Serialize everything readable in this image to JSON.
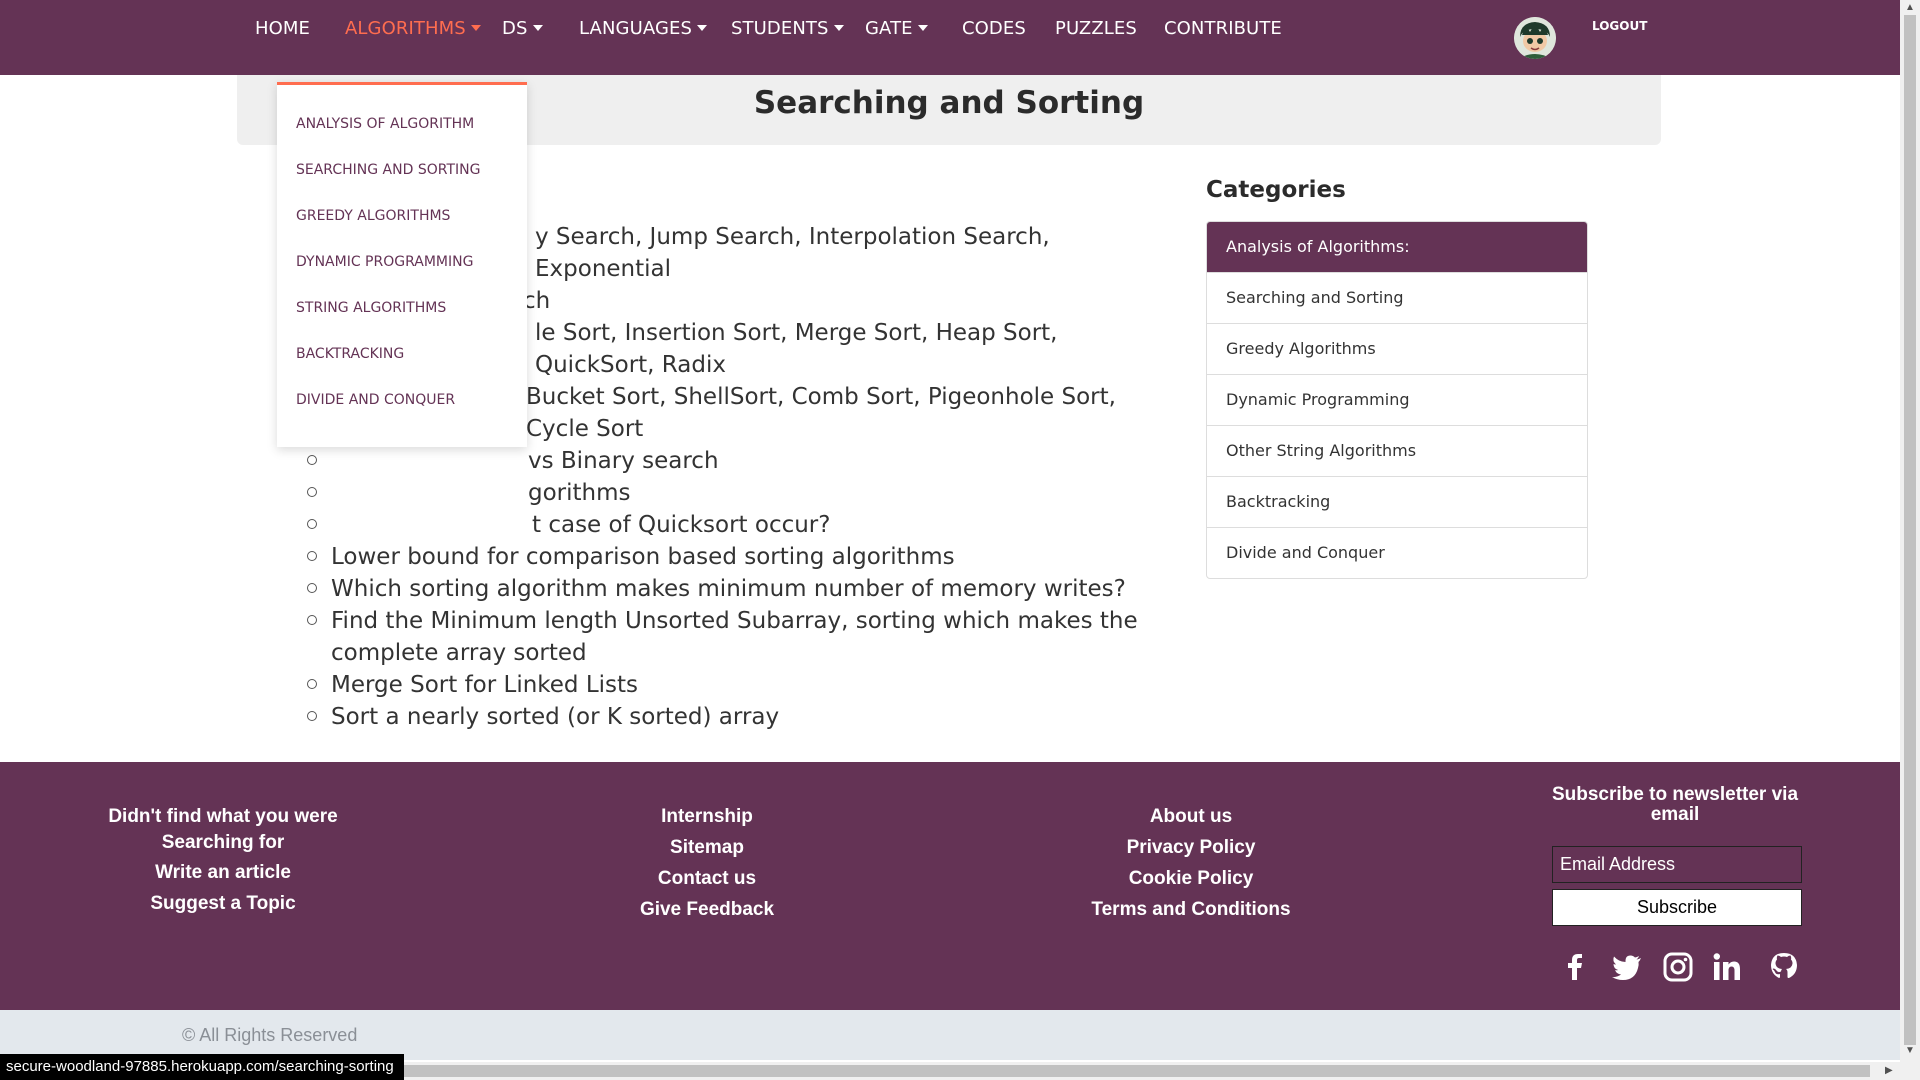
{
  "nav": {
    "items": [
      {
        "label": "HOME",
        "dropdown": false
      },
      {
        "label": "ALGORITHMS",
        "dropdown": true,
        "active": true
      },
      {
        "label": "DS",
        "dropdown": true
      },
      {
        "label": "LANGUAGES",
        "dropdown": true
      },
      {
        "label": "STUDENTS",
        "dropdown": true
      },
      {
        "label": "GATE",
        "dropdown": true
      },
      {
        "label": "CODES",
        "dropdown": false
      },
      {
        "label": "PUZZLES",
        "dropdown": false
      },
      {
        "label": "CONTRIBUTE",
        "dropdown": false
      }
    ],
    "logout_label": "LOGOUT",
    "avatar_icon": "avatar-cartoon-character",
    "background_color": "#643355",
    "active_color": "#ff6d4f"
  },
  "dropdown": {
    "items": [
      "ANALYSIS OF ALGORITHM",
      "SEARCHING AND SORTING",
      "GREEDY ALGORITHMS",
      "DYNAMIC PROGRAMMING",
      "STRING ALGORITHMS",
      "BACKTRACKING",
      "DIVIDE AND CONQUER"
    ]
  },
  "page": {
    "title": "Searching and Sorting"
  },
  "articles": [
    "y Search, Jump Search, Interpolation Search, Exponential",
    "ch",
    "le Sort, Insertion Sort, Merge Sort, Heap Sort, QuickSort, Radix",
    "Bucket Sort, ShellSort, Comb Sort, Pigeonhole Sort, Cycle Sort",
    "vs Binary search",
    "gorithms",
    "t case of Quicksort occur?",
    "Lower bound for comparison based sorting algorithms",
    "Which sorting algorithm makes minimum number of memory writes?",
    "Find the Minimum length Unsorted Subarray, sorting which makes the complete array sorted",
    "Merge Sort for Linked Lists",
    "Sort a nearly sorted (or K sorted) array"
  ],
  "sidebar": {
    "heading": "Categories",
    "items": [
      {
        "label": "Analysis of Algorithms:",
        "active": true
      },
      {
        "label": "Searching and Sorting",
        "active": false
      },
      {
        "label": "Greedy Algorithms",
        "active": false
      },
      {
        "label": "Dynamic Programming",
        "active": false
      },
      {
        "label": "Other String Algorithms",
        "active": false
      },
      {
        "label": "Backtracking",
        "active": false
      },
      {
        "label": "Divide and Conquer",
        "active": false
      }
    ]
  },
  "footer": {
    "col1": {
      "line1": "Didn't find what you were",
      "line2": "Searching for",
      "write": "Write an article",
      "suggest": "Suggest a Topic"
    },
    "col2": [
      "Internship",
      "Sitemap",
      "Contact us",
      "Give Feedback"
    ],
    "col3": [
      "About us",
      "Privacy Policy",
      "Cookie Policy",
      "Terms and Conditions"
    ],
    "newsletter": {
      "heading": "Subscribe to newsletter via email",
      "email_placeholder": "Email Address",
      "subscribe_label": "Subscribe"
    },
    "social_icons": [
      "facebook-icon",
      "twitter-icon",
      "instagram-icon",
      "linkedin-icon",
      "github-icon"
    ],
    "copyright": "© All Rights Reserved"
  },
  "status_url": "secure-woodland-97885.herokuapp.com/searching-sorting"
}
